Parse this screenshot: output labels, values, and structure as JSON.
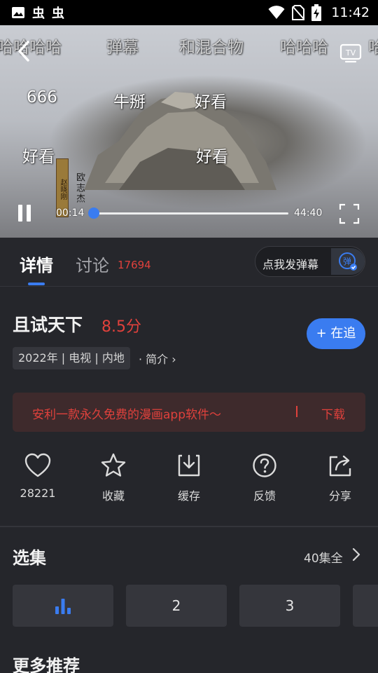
{
  "status_bar": {
    "time": "11:42",
    "left_icons": [
      "image-icon",
      "app-icon",
      "app-icon"
    ],
    "left_glyphs": [
      "虫",
      "虫"
    ],
    "right_icons": [
      "wifi-icon",
      "no-sim-icon",
      "battery-charging-icon"
    ]
  },
  "player": {
    "danmaku": {
      "row1": [
        "哈哈哈哈",
        "弹幕",
        "和混合物",
        "哈哈哈",
        "哈"
      ],
      "row2": [
        "666",
        "牛掰",
        "好看"
      ],
      "row3": [
        "好看",
        "好看"
      ]
    },
    "seal_text": "赵晓刚",
    "calligraphy": "欧志杰",
    "current_time": "00:14",
    "total_time": "44:40",
    "progress_fraction": 0.005,
    "accent_color": "#3a7cf0"
  },
  "tabs": {
    "details": "详情",
    "discuss": "讨论",
    "discuss_count": "17694",
    "send_danmaku": "点我发弹幕",
    "danmaku_badge": "弹"
  },
  "show": {
    "title": "且试天下",
    "score": "8.5分",
    "meta": "2022年 | 电视 | 内地",
    "intro": "· 简介 ›",
    "follow": "+ 在追"
  },
  "ad": {
    "text": "安利一款永久免费的漫画app软件～",
    "download": "下载"
  },
  "actions": [
    {
      "icon": "heart-icon",
      "label": "28221"
    },
    {
      "icon": "star-icon",
      "label": "收藏"
    },
    {
      "icon": "download-icon",
      "label": "缓存"
    },
    {
      "icon": "question-icon",
      "label": "反馈"
    },
    {
      "icon": "share-icon",
      "label": "分享"
    }
  ],
  "episodes": {
    "title": "选集",
    "count": "40集全",
    "items": [
      "2",
      "3"
    ]
  },
  "more": {
    "title": "更多推荐"
  }
}
